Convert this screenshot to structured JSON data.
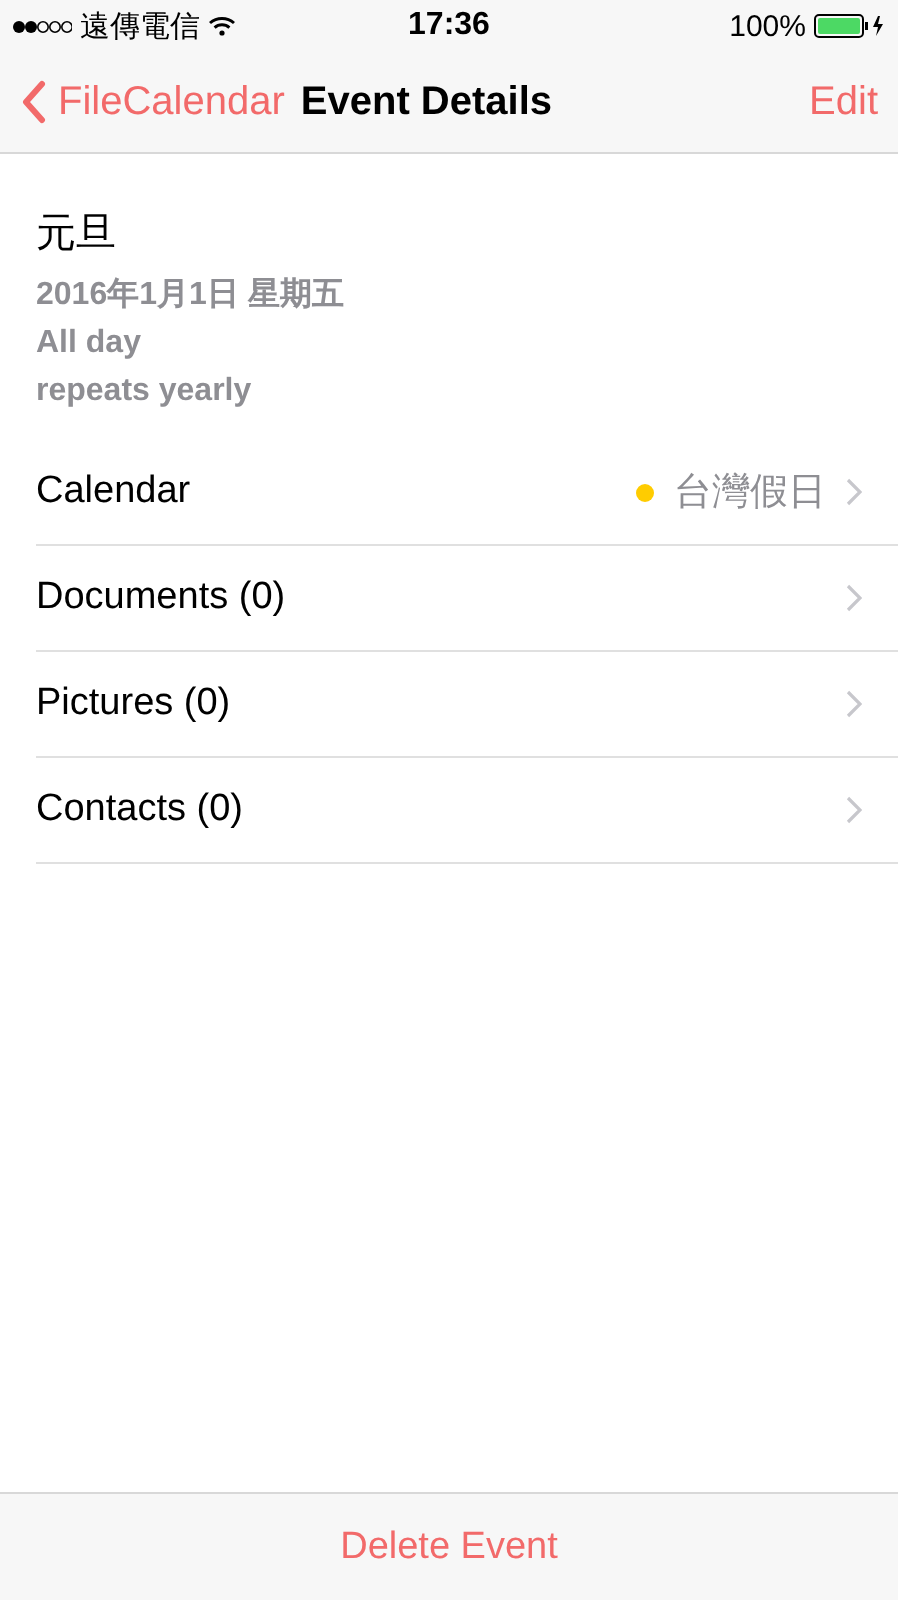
{
  "status_bar": {
    "carrier": "遠傳電信",
    "time": "17:36",
    "battery": "100%"
  },
  "nav_bar": {
    "back": "FileCalendar",
    "title": "Event Details",
    "action": "Edit"
  },
  "event": {
    "title": "元旦",
    "date": "2016年1月1日 星期五",
    "time": "All day",
    "recurrence": "repeats yearly"
  },
  "rows": [
    {
      "label": "Calendar",
      "value": "台灣假日",
      "color": "#ffcc00"
    },
    {
      "label": "Documents (0)"
    },
    {
      "label": "Pictures (0)"
    },
    {
      "label": "Contacts (0)"
    }
  ],
  "toolbar": {
    "button": "Delete Event"
  }
}
